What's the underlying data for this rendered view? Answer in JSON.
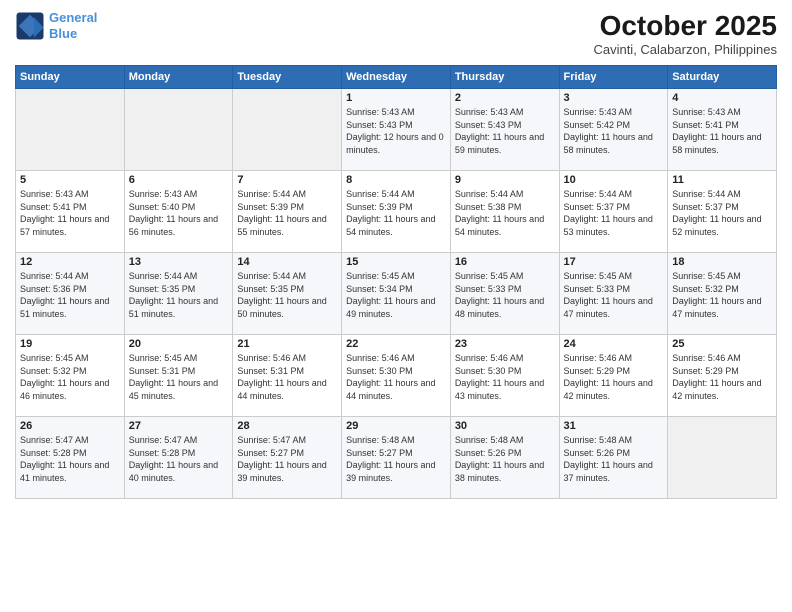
{
  "logo": {
    "line1": "General",
    "line2": "Blue"
  },
  "title": "October 2025",
  "location": "Cavinti, Calabarzon, Philippines",
  "weekdays": [
    "Sunday",
    "Monday",
    "Tuesday",
    "Wednesday",
    "Thursday",
    "Friday",
    "Saturday"
  ],
  "weeks": [
    [
      {
        "day": "",
        "sunrise": "",
        "sunset": "",
        "daylight": ""
      },
      {
        "day": "",
        "sunrise": "",
        "sunset": "",
        "daylight": ""
      },
      {
        "day": "",
        "sunrise": "",
        "sunset": "",
        "daylight": ""
      },
      {
        "day": "1",
        "sunrise": "Sunrise: 5:43 AM",
        "sunset": "Sunset: 5:43 PM",
        "daylight": "Daylight: 12 hours and 0 minutes."
      },
      {
        "day": "2",
        "sunrise": "Sunrise: 5:43 AM",
        "sunset": "Sunset: 5:43 PM",
        "daylight": "Daylight: 11 hours and 59 minutes."
      },
      {
        "day": "3",
        "sunrise": "Sunrise: 5:43 AM",
        "sunset": "Sunset: 5:42 PM",
        "daylight": "Daylight: 11 hours and 58 minutes."
      },
      {
        "day": "4",
        "sunrise": "Sunrise: 5:43 AM",
        "sunset": "Sunset: 5:41 PM",
        "daylight": "Daylight: 11 hours and 58 minutes."
      }
    ],
    [
      {
        "day": "5",
        "sunrise": "Sunrise: 5:43 AM",
        "sunset": "Sunset: 5:41 PM",
        "daylight": "Daylight: 11 hours and 57 minutes."
      },
      {
        "day": "6",
        "sunrise": "Sunrise: 5:43 AM",
        "sunset": "Sunset: 5:40 PM",
        "daylight": "Daylight: 11 hours and 56 minutes."
      },
      {
        "day": "7",
        "sunrise": "Sunrise: 5:44 AM",
        "sunset": "Sunset: 5:39 PM",
        "daylight": "Daylight: 11 hours and 55 minutes."
      },
      {
        "day": "8",
        "sunrise": "Sunrise: 5:44 AM",
        "sunset": "Sunset: 5:39 PM",
        "daylight": "Daylight: 11 hours and 54 minutes."
      },
      {
        "day": "9",
        "sunrise": "Sunrise: 5:44 AM",
        "sunset": "Sunset: 5:38 PM",
        "daylight": "Daylight: 11 hours and 54 minutes."
      },
      {
        "day": "10",
        "sunrise": "Sunrise: 5:44 AM",
        "sunset": "Sunset: 5:37 PM",
        "daylight": "Daylight: 11 hours and 53 minutes."
      },
      {
        "day": "11",
        "sunrise": "Sunrise: 5:44 AM",
        "sunset": "Sunset: 5:37 PM",
        "daylight": "Daylight: 11 hours and 52 minutes."
      }
    ],
    [
      {
        "day": "12",
        "sunrise": "Sunrise: 5:44 AM",
        "sunset": "Sunset: 5:36 PM",
        "daylight": "Daylight: 11 hours and 51 minutes."
      },
      {
        "day": "13",
        "sunrise": "Sunrise: 5:44 AM",
        "sunset": "Sunset: 5:35 PM",
        "daylight": "Daylight: 11 hours and 51 minutes."
      },
      {
        "day": "14",
        "sunrise": "Sunrise: 5:44 AM",
        "sunset": "Sunset: 5:35 PM",
        "daylight": "Daylight: 11 hours and 50 minutes."
      },
      {
        "day": "15",
        "sunrise": "Sunrise: 5:45 AM",
        "sunset": "Sunset: 5:34 PM",
        "daylight": "Daylight: 11 hours and 49 minutes."
      },
      {
        "day": "16",
        "sunrise": "Sunrise: 5:45 AM",
        "sunset": "Sunset: 5:33 PM",
        "daylight": "Daylight: 11 hours and 48 minutes."
      },
      {
        "day": "17",
        "sunrise": "Sunrise: 5:45 AM",
        "sunset": "Sunset: 5:33 PM",
        "daylight": "Daylight: 11 hours and 47 minutes."
      },
      {
        "day": "18",
        "sunrise": "Sunrise: 5:45 AM",
        "sunset": "Sunset: 5:32 PM",
        "daylight": "Daylight: 11 hours and 47 minutes."
      }
    ],
    [
      {
        "day": "19",
        "sunrise": "Sunrise: 5:45 AM",
        "sunset": "Sunset: 5:32 PM",
        "daylight": "Daylight: 11 hours and 46 minutes."
      },
      {
        "day": "20",
        "sunrise": "Sunrise: 5:45 AM",
        "sunset": "Sunset: 5:31 PM",
        "daylight": "Daylight: 11 hours and 45 minutes."
      },
      {
        "day": "21",
        "sunrise": "Sunrise: 5:46 AM",
        "sunset": "Sunset: 5:31 PM",
        "daylight": "Daylight: 11 hours and 44 minutes."
      },
      {
        "day": "22",
        "sunrise": "Sunrise: 5:46 AM",
        "sunset": "Sunset: 5:30 PM",
        "daylight": "Daylight: 11 hours and 44 minutes."
      },
      {
        "day": "23",
        "sunrise": "Sunrise: 5:46 AM",
        "sunset": "Sunset: 5:30 PM",
        "daylight": "Daylight: 11 hours and 43 minutes."
      },
      {
        "day": "24",
        "sunrise": "Sunrise: 5:46 AM",
        "sunset": "Sunset: 5:29 PM",
        "daylight": "Daylight: 11 hours and 42 minutes."
      },
      {
        "day": "25",
        "sunrise": "Sunrise: 5:46 AM",
        "sunset": "Sunset: 5:29 PM",
        "daylight": "Daylight: 11 hours and 42 minutes."
      }
    ],
    [
      {
        "day": "26",
        "sunrise": "Sunrise: 5:47 AM",
        "sunset": "Sunset: 5:28 PM",
        "daylight": "Daylight: 11 hours and 41 minutes."
      },
      {
        "day": "27",
        "sunrise": "Sunrise: 5:47 AM",
        "sunset": "Sunset: 5:28 PM",
        "daylight": "Daylight: 11 hours and 40 minutes."
      },
      {
        "day": "28",
        "sunrise": "Sunrise: 5:47 AM",
        "sunset": "Sunset: 5:27 PM",
        "daylight": "Daylight: 11 hours and 39 minutes."
      },
      {
        "day": "29",
        "sunrise": "Sunrise: 5:48 AM",
        "sunset": "Sunset: 5:27 PM",
        "daylight": "Daylight: 11 hours and 39 minutes."
      },
      {
        "day": "30",
        "sunrise": "Sunrise: 5:48 AM",
        "sunset": "Sunset: 5:26 PM",
        "daylight": "Daylight: 11 hours and 38 minutes."
      },
      {
        "day": "31",
        "sunrise": "Sunrise: 5:48 AM",
        "sunset": "Sunset: 5:26 PM",
        "daylight": "Daylight: 11 hours and 37 minutes."
      },
      {
        "day": "",
        "sunrise": "",
        "sunset": "",
        "daylight": ""
      }
    ]
  ]
}
